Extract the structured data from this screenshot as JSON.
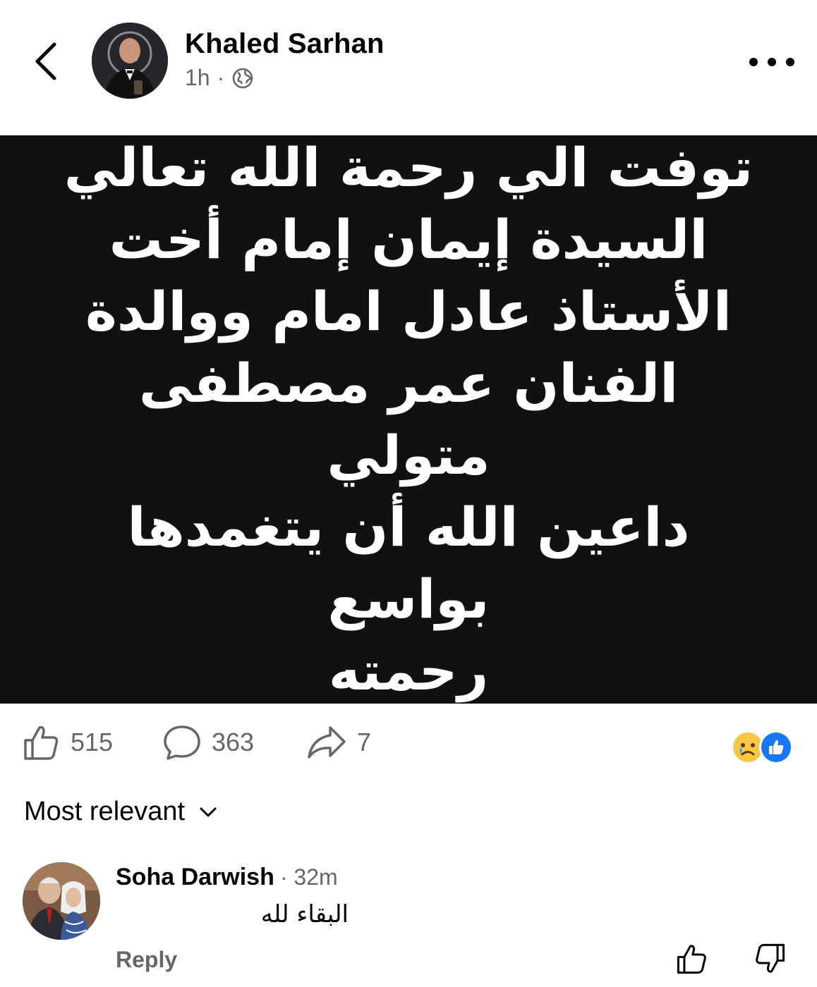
{
  "post": {
    "author": "Khaled Sarhan",
    "time": "1h",
    "separator": "·",
    "privacy_icon": "globe-icon",
    "image_text": "توفت الي رحمة الله تعالي\nالسيدة إيمان إمام أخت\nالأستاذ عادل امام ووالدة\nالفنان عمر مصطفى متولي\nداعين الله أن يتغمدها بواسع\nرحمته"
  },
  "actions": {
    "likes": "515",
    "comments": "363",
    "shares": "7",
    "reaction_icons": [
      "sad-reaction-icon",
      "like-reaction-icon"
    ]
  },
  "sort": {
    "label": "Most relevant"
  },
  "comments": [
    {
      "name": "Soha Darwish",
      "time": "· 32m",
      "text": "البقاء لله",
      "reply_label": "Reply"
    }
  ],
  "colors": {
    "image_bg": "#111111",
    "meta_gray": "#65676b",
    "like_blue": "#1877f2",
    "sad_yellow": "#f7c843"
  }
}
